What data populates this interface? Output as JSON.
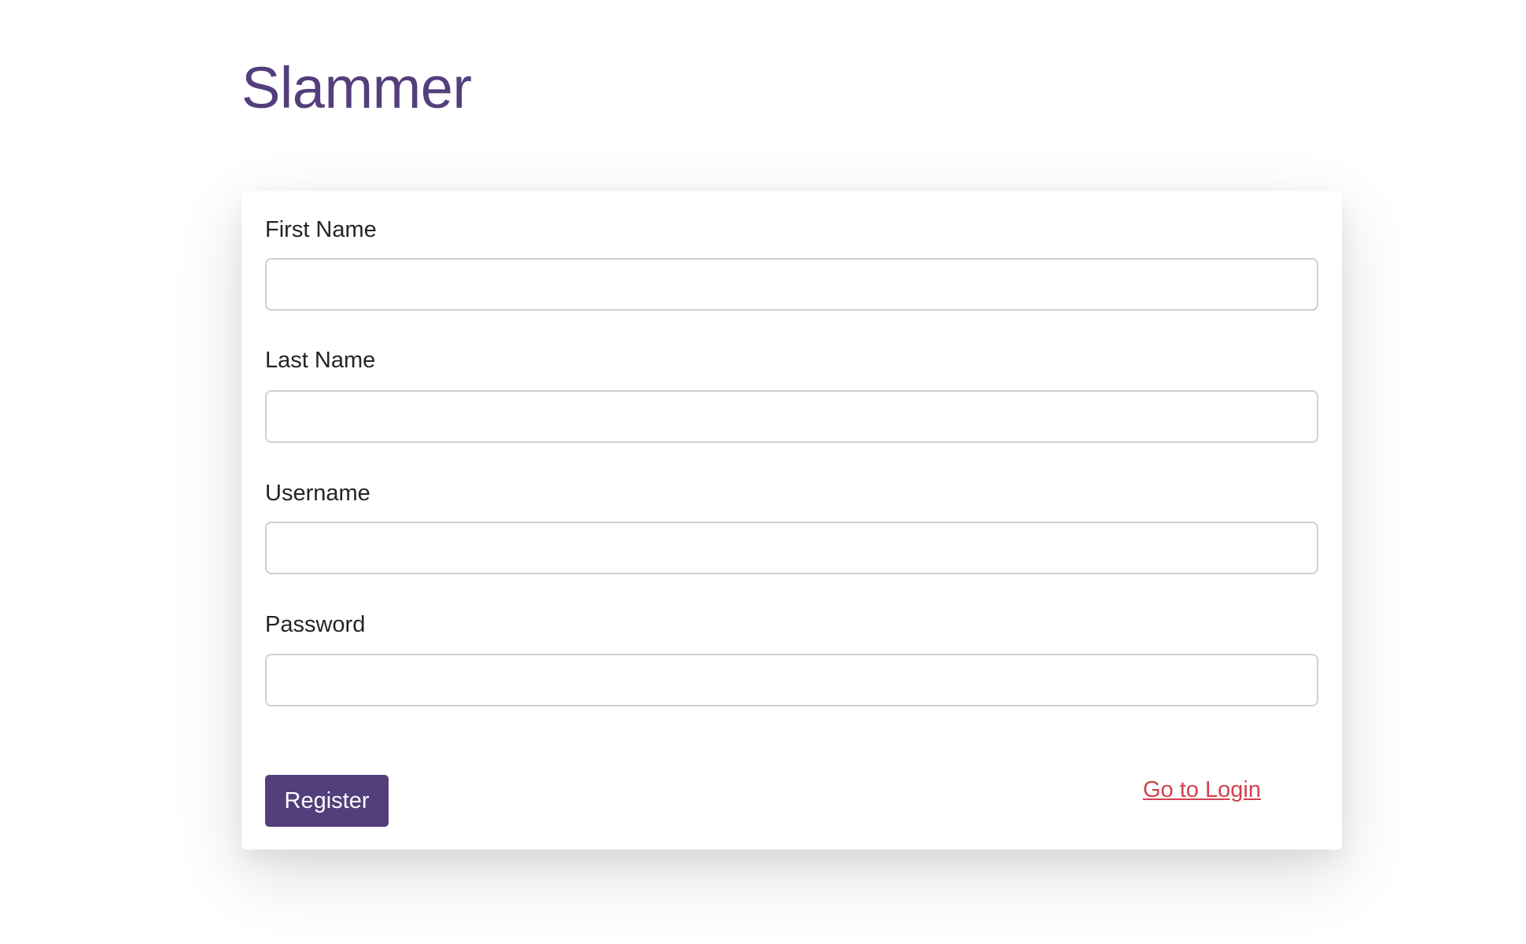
{
  "header": {
    "title": "Slammer"
  },
  "form": {
    "fields": [
      {
        "label": "First Name",
        "value": "",
        "placeholder": ""
      },
      {
        "label": "Last Name",
        "value": "",
        "placeholder": ""
      },
      {
        "label": "Username",
        "value": "",
        "placeholder": ""
      },
      {
        "label": "Password",
        "value": "",
        "placeholder": ""
      }
    ],
    "register_label": "Register",
    "login_link_label": "Go to Login"
  },
  "colors": {
    "brand": "#533f7c",
    "link": "#d0424f",
    "background": "#ffffff"
  }
}
